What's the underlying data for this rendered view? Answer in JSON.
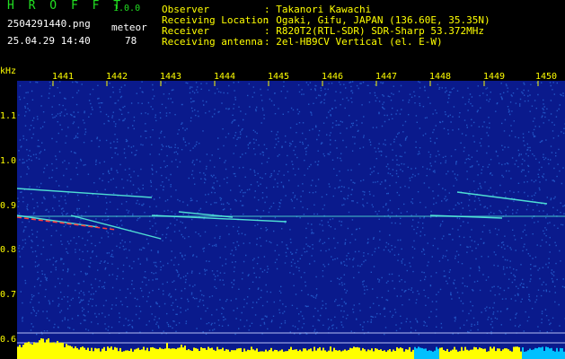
{
  "header": {
    "brand": "H R O F F T",
    "version": "1.0.0",
    "filename": "2504291440.png",
    "meteor_label": "meteor",
    "timestamp": "25.04.29 14:40",
    "meteor_count": "78",
    "labels": "Observer\nReceiving Location\nReceiver\nReceiving antenna",
    "values": ": Takanori Kawachi\n: Ogaki, Gifu, JAPAN (136.60E, 35.35N)\n: R820T2(RTL-SDR) SDR-Sharp 53.372MHz\n: 2el-HB9CV Vertical (el. E-W)"
  },
  "spectrogram": {
    "y_unit": "kHz",
    "x_ticks": [
      "1441",
      "1442",
      "1443",
      "1444",
      "1445",
      "1446",
      "1447",
      "1448",
      "1449",
      "1450"
    ],
    "y_ticks": [
      "1.1",
      "1.0",
      "0.9",
      "0.8",
      "0.7",
      "0.6"
    ],
    "colors": {
      "background": "#0a1a8c",
      "noise": "#2a6ad8",
      "trail": "#5affe0",
      "hot": "#ff3a3a",
      "level": "#ffff00",
      "level_alt": "#00c0ff"
    }
  }
}
